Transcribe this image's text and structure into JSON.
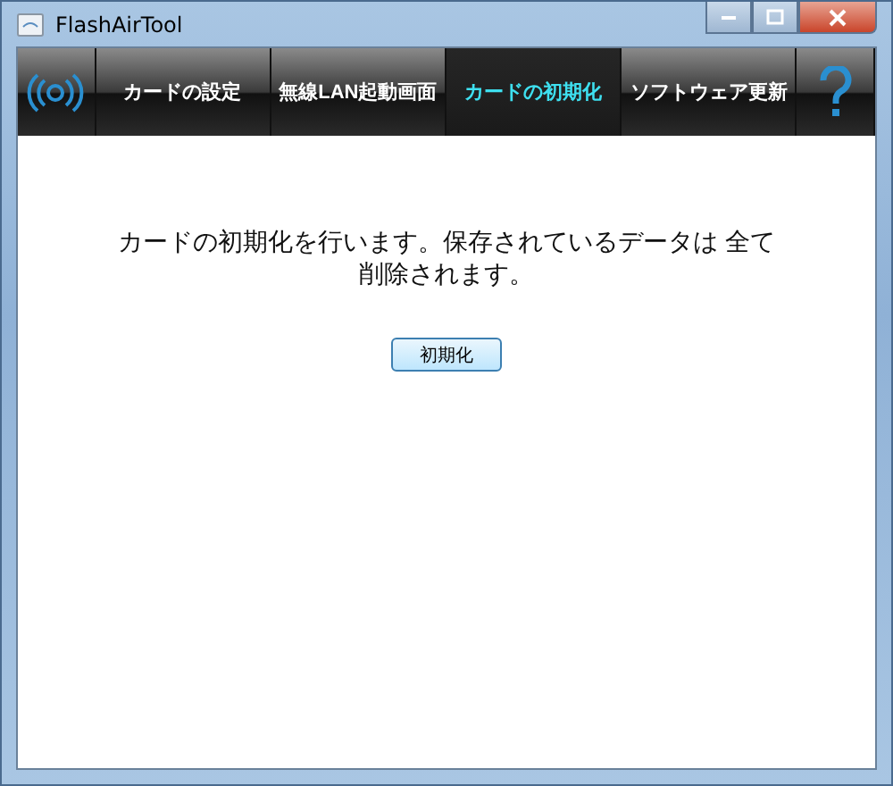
{
  "window": {
    "title": "FlashAirTool"
  },
  "tabs": [
    {
      "label": "カードの設定",
      "selected": false
    },
    {
      "label": "無線LAN起動画面",
      "selected": false
    },
    {
      "label": "カードの初期化",
      "selected": true
    },
    {
      "label": "ソフトウェア更新",
      "selected": false
    }
  ],
  "message_lines": [
    "カードの初期化を行います。保存されているデータは 全て",
    "削除されます。"
  ],
  "button": "初期化"
}
